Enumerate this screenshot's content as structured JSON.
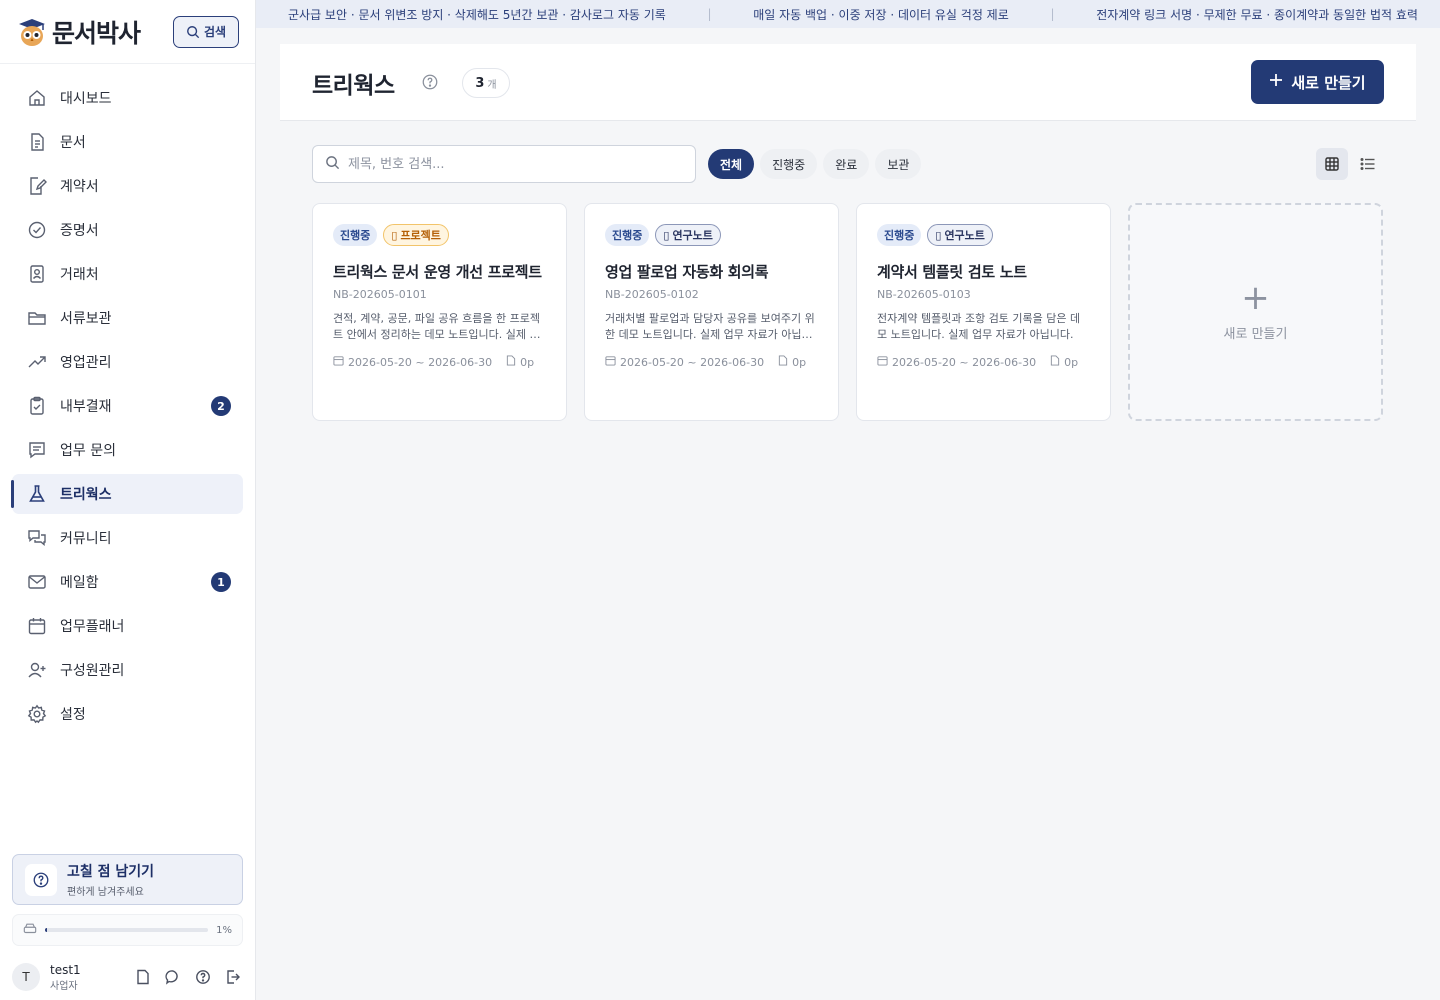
{
  "app": {
    "logo_text": "문서박사",
    "search_button": "검색"
  },
  "banner": {
    "items": [
      "군사급 보안 · 문서 위변조 방지 · 삭제해도 5년간 보관 · 감사로그 자동 기록",
      "매일 자동 백업 · 이중 저장 · 데이터 유실 걱정 제로",
      "전자계약 링크 서명 · 무제한 무료 · 종이계약과 동일한 법적 효력"
    ]
  },
  "sidebar": {
    "items": [
      {
        "label": "대시보드",
        "icon": "home-icon"
      },
      {
        "label": "문서",
        "icon": "document-icon"
      },
      {
        "label": "계약서",
        "icon": "contract-icon"
      },
      {
        "label": "증명서",
        "icon": "certificate-icon"
      },
      {
        "label": "거래처",
        "icon": "contact-card-icon"
      },
      {
        "label": "서류보관",
        "icon": "folder-icon"
      },
      {
        "label": "영업관리",
        "icon": "trend-icon"
      },
      {
        "label": "내부결재",
        "icon": "clipboard-check-icon",
        "badge": "2"
      },
      {
        "label": "업무 문의",
        "icon": "message-icon"
      },
      {
        "label": "트리웍스",
        "icon": "flask-icon",
        "active": true
      },
      {
        "label": "커뮤니티",
        "icon": "chat-icon"
      },
      {
        "label": "메일함",
        "icon": "mail-icon",
        "badge": "1"
      },
      {
        "label": "업무플래너",
        "icon": "calendar-icon"
      },
      {
        "label": "구성원관리",
        "icon": "user-add-icon"
      },
      {
        "label": "설정",
        "icon": "gear-icon"
      }
    ],
    "feedback": {
      "title": "고칠 점 남기기",
      "subtitle": "편하게 남겨주세요"
    },
    "storage": {
      "percent_label": "1%",
      "fill_fraction": 0.01
    },
    "user": {
      "avatar_letter": "T",
      "name": "test1",
      "role": "사업자"
    }
  },
  "main": {
    "title": "트리웍스",
    "count": "3",
    "count_unit": "개",
    "new_button": "새로 만들기",
    "search_placeholder": "제목, 번호 검색...",
    "filters": [
      "전체",
      "진행중",
      "완료",
      "보관"
    ],
    "active_filter": "전체",
    "view_mode": "grid",
    "cards": [
      {
        "status": "진행중",
        "type": "프로젝트",
        "title": "트리웍스 문서 운영 개선 프로젝트",
        "number": "NB-202605-0101",
        "description": "견적, 계약, 공문, 파일 공유 흐름을 한 프로젝트 안에서 정리하는 데모 노트입니다. 실제 업무 자료가 아닙니다.",
        "dates": "2026-05-20 ~ 2026-06-30",
        "pages": "0p"
      },
      {
        "status": "진행중",
        "type": "연구노트",
        "title": "영업 팔로업 자동화 회의록",
        "number": "NB-202605-0102",
        "description": "거래처별 팔로업과 담당자 공유를 보여주기 위한 데모 노트입니다. 실제 업무 자료가 아닙니다.",
        "dates": "2026-05-20 ~ 2026-06-30",
        "pages": "0p"
      },
      {
        "status": "진행중",
        "type": "연구노트",
        "title": "계약서 템플릿 검토 노트",
        "number": "NB-202605-0103",
        "description": "전자계약 템플릿과 조항 검토 기록을 담은 데모 노트입니다. 실제 업무 자료가 아닙니다.",
        "dates": "2026-05-20 ~ 2026-06-30",
        "pages": "0p"
      }
    ],
    "new_card_label": "새로 만들기"
  },
  "colors": {
    "primary": "#233a75",
    "active_bg": "#eef1f9",
    "project_tag": "#b45f06"
  }
}
